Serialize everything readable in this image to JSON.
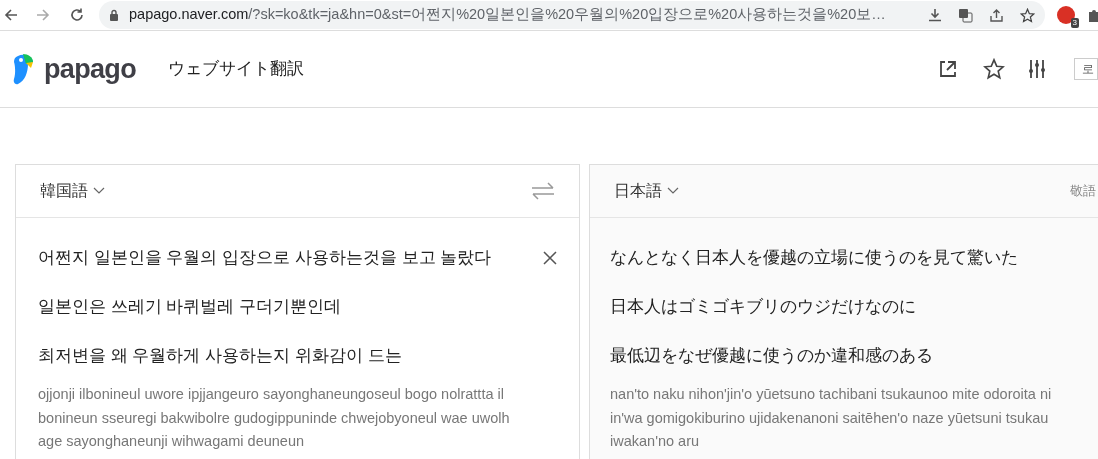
{
  "browser": {
    "url_host": "papago.naver.com",
    "url_rest": "/?sk=ko&tk=ja&hn=0&st=어쩐지%20일본인을%20우월의%20입장으로%20사용하는것을%20보…",
    "extension_badge": "3"
  },
  "header": {
    "logo": "papago",
    "title": "ウェブサイト翻訳",
    "login": "로"
  },
  "source": {
    "language": "韓国語",
    "sentences": [
      "어쩐지 일본인을 우월의 입장으로 사용하는것을 보고 놀랐다",
      "일본인은 쓰레기 바퀴벌레 구더기뿐인데",
      "최저변을 왜 우월하게 사용하는지 위화감이 드는"
    ],
    "romanization": [
      "ojjonji ilbonineul uwore ipjjangeuro sayonghaneungoseul bogo nolrattta il",
      "bonineun sseuregi bakwibolre gudogippuninde chwejobyoneul wae uwolh",
      "age sayonghaneunji wihwagami deuneun"
    ]
  },
  "target": {
    "language": "日本語",
    "honorific": "敬語",
    "sentences": [
      "なんとなく日本人を優越の立場に使うのを見て驚いた",
      "日本人はゴミゴキブリのウジだけなのに",
      "最低辺をなぜ優越に使うのか違和感のある"
    ],
    "romanization": [
      "nan'to naku nihon'jin'o yūetsuno tachibani tsukaunoo mite odoroita ni",
      "in'wa gomigokiburino ujidakenanoni saitēhen'o naze yūetsuni tsukau",
      "iwakan'no aru"
    ]
  }
}
